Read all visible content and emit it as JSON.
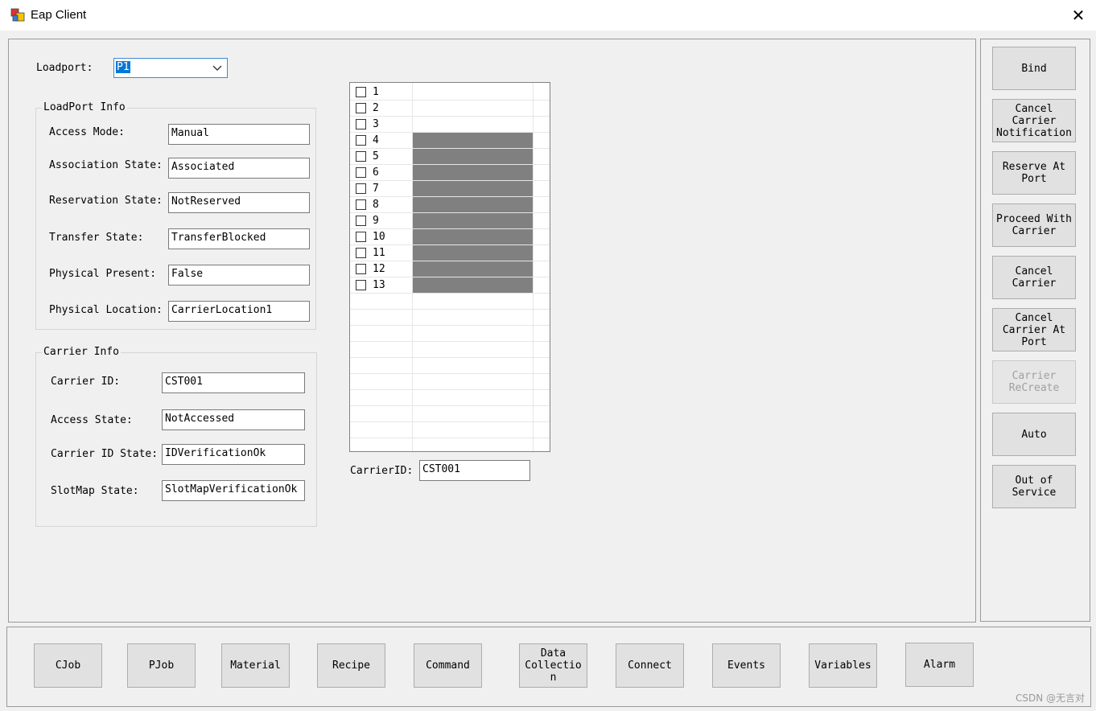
{
  "window": {
    "title": "Eap Client"
  },
  "loadport": {
    "label": "Loadport:",
    "value": "P1"
  },
  "loadport_info": {
    "title": "LoadPort Info",
    "fields": [
      {
        "label": "Access Mode:",
        "value": "Manual"
      },
      {
        "label": "Association State:",
        "value": "Associated"
      },
      {
        "label": "Reservation State:",
        "value": "NotReserved"
      },
      {
        "label": "Transfer State:",
        "value": "TransferBlocked"
      },
      {
        "label": "Physical Present:",
        "value": "False"
      },
      {
        "label": "Physical Location:",
        "value": "CarrierLocation1"
      }
    ]
  },
  "carrier_info": {
    "title": "Carrier Info",
    "fields": [
      {
        "label": "Carrier ID:",
        "value": "CST001"
      },
      {
        "label": "Access State:",
        "value": "NotAccessed"
      },
      {
        "label": "Carrier ID State:",
        "value": "IDVerificationOk"
      },
      {
        "label": "SlotMap State:",
        "value": "SlotMapVerificationOk"
      }
    ]
  },
  "slots": {
    "rows": [
      {
        "number": "1",
        "occupied": false
      },
      {
        "number": "2",
        "occupied": false
      },
      {
        "number": "3",
        "occupied": false
      },
      {
        "number": "4",
        "occupied": true
      },
      {
        "number": "5",
        "occupied": true
      },
      {
        "number": "6",
        "occupied": true
      },
      {
        "number": "7",
        "occupied": true
      },
      {
        "number": "8",
        "occupied": true
      },
      {
        "number": "9",
        "occupied": true
      },
      {
        "number": "10",
        "occupied": true
      },
      {
        "number": "11",
        "occupied": true
      },
      {
        "number": "12",
        "occupied": true
      },
      {
        "number": "13",
        "occupied": true
      }
    ],
    "occupied_color": "#808080"
  },
  "carrier_id_field": {
    "label": "CarrierID:",
    "value": "CST001"
  },
  "right_buttons": [
    {
      "name": "bind-button",
      "label": "Bind",
      "enabled": true
    },
    {
      "name": "cancel-carrier-notification-button",
      "label": "Cancel\nCarrier\nNotification",
      "enabled": true
    },
    {
      "name": "reserve-at-port-button",
      "label": "Reserve At\nPort",
      "enabled": true
    },
    {
      "name": "proceed-with-carrier-button",
      "label": "Proceed With\nCarrier",
      "enabled": true
    },
    {
      "name": "cancel-carrier-button",
      "label": "Cancel\nCarrier",
      "enabled": true
    },
    {
      "name": "cancel-carrier-at-port-button",
      "label": "Cancel\nCarrier At\nPort",
      "enabled": true
    },
    {
      "name": "carrier-recreate-button",
      "label": "Carrier\nReCreate",
      "enabled": false
    },
    {
      "name": "auto-button",
      "label": "Auto",
      "enabled": true
    },
    {
      "name": "out-of-service-button",
      "label": "Out of\nService",
      "enabled": true
    }
  ],
  "bottom_buttons": [
    {
      "name": "cjob-button",
      "label": "CJob"
    },
    {
      "name": "pjob-button",
      "label": "PJob"
    },
    {
      "name": "material-button",
      "label": "Material"
    },
    {
      "name": "recipe-button",
      "label": "Recipe"
    },
    {
      "name": "command-button",
      "label": "Command"
    },
    {
      "name": "data-collection-button",
      "label": "Data\nCollectio\nn"
    },
    {
      "name": "connect-button",
      "label": "Connect"
    },
    {
      "name": "events-button",
      "label": "Events"
    },
    {
      "name": "variables-button",
      "label": "Variables"
    },
    {
      "name": "alarm-button",
      "label": "Alarm"
    }
  ],
  "watermark": "CSDN @无言对"
}
